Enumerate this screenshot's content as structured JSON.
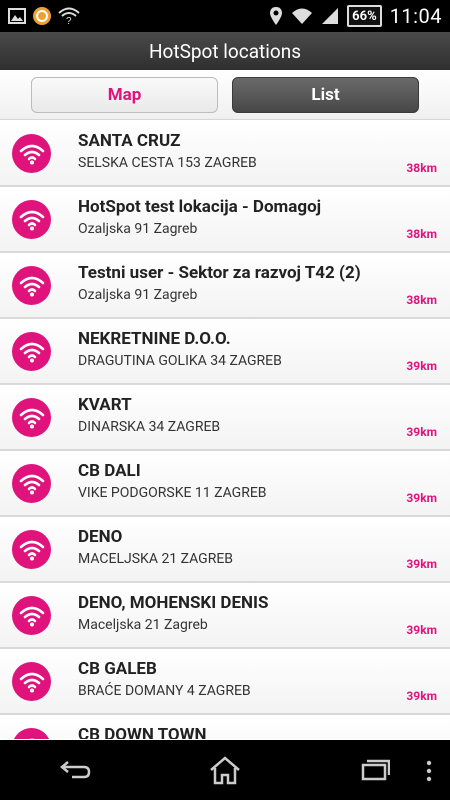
{
  "status_bar": {
    "battery": "66%",
    "time": "11:04",
    "icons": [
      "gallery-icon",
      "sync-app-icon",
      "wifi-question-icon",
      "location-pin-icon",
      "wifi-signal-icon",
      "cell-signal-icon",
      "battery-icon"
    ]
  },
  "header": {
    "title": "HotSpot locations"
  },
  "tabs": [
    {
      "label": "Map",
      "selected": false
    },
    {
      "label": "List",
      "selected": true
    }
  ],
  "list": [
    {
      "name": "SANTA CRUZ",
      "address": "SELSKA CESTA 153 ZAGREB",
      "distance": "38km"
    },
    {
      "name": "HotSpot test lokacija - Domagoj",
      "address": "Ozaljska 91 Zagreb",
      "distance": "38km"
    },
    {
      "name": "Testni user - Sektor za razvoj T42 (2)",
      "address": "Ozaljska 91 Zagreb",
      "distance": "38km"
    },
    {
      "name": "NEKRETNINE D.O.O.",
      "address": "DRAGUTINA GOLIKA 34  ZAGREB",
      "distance": "39km"
    },
    {
      "name": "KVART",
      "address": "DINARSKA 34 ZAGREB",
      "distance": "39km"
    },
    {
      "name": "CB DALI",
      "address": "VIKE PODGORSKE 11 ZAGREB",
      "distance": "39km"
    },
    {
      "name": "DENO",
      "address": "MACELJSKA 21 ZAGREB",
      "distance": "39km"
    },
    {
      "name": "DENO, MOHENSKI DENIS",
      "address": "Maceljska 21 Zagreb",
      "distance": "39km"
    },
    {
      "name": "CB GALEB",
      "address": "BRAĆE DOMANY 4 ZAGREB",
      "distance": "39km"
    },
    {
      "name": "CB DOWN TOWN",
      "address": "",
      "distance": ""
    }
  ],
  "colors": {
    "accent": "#e0137c",
    "title_bar": "#3a3a3a"
  }
}
